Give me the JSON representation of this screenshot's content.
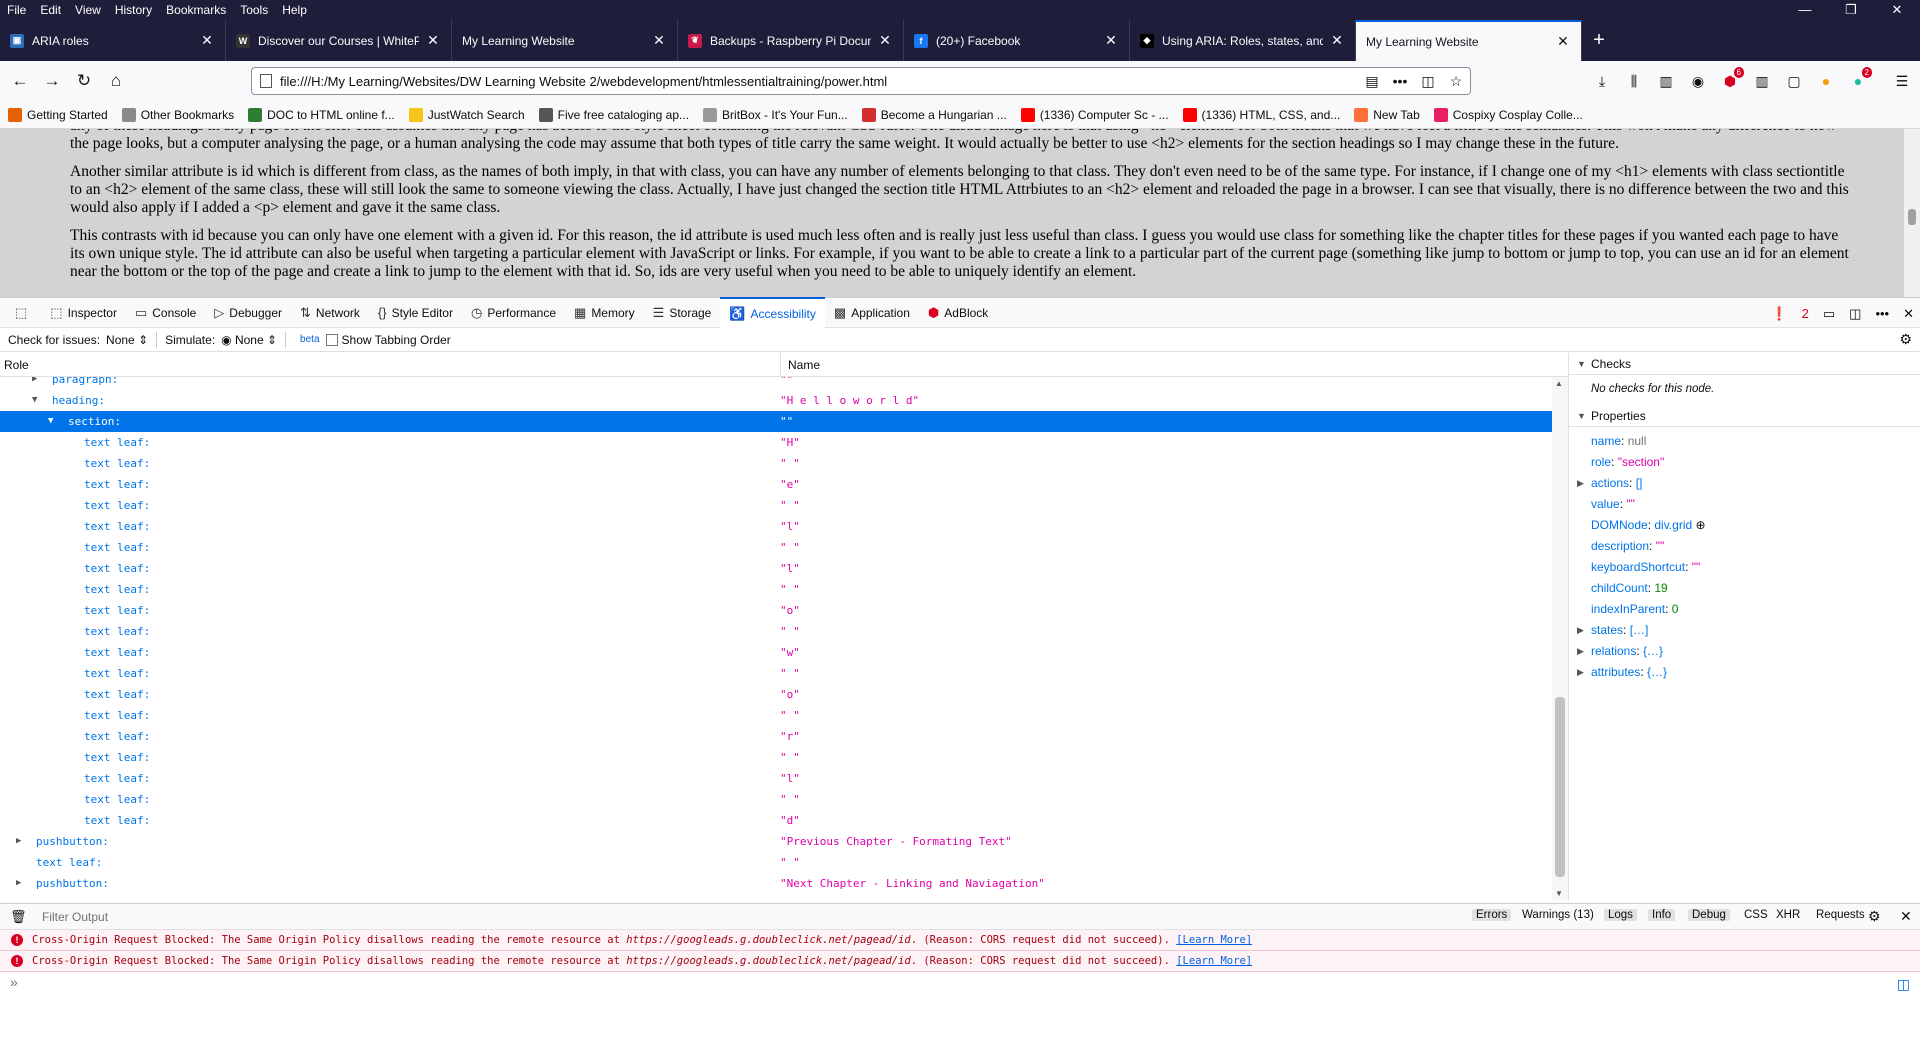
{
  "menu": [
    "File",
    "Edit",
    "View",
    "History",
    "Bookmarks",
    "Tools",
    "Help"
  ],
  "window_controls": [
    "—",
    "❐",
    "✕"
  ],
  "tabs": [
    {
      "title": "ARIA roles",
      "fav_color": "#2a6ebb",
      "fav_text": "▣"
    },
    {
      "title": "Discover our Courses | WhitePe",
      "fav_color": "#333333",
      "fav_text": "W"
    },
    {
      "title": "My Learning Website",
      "fav_color": "",
      "fav_text": ""
    },
    {
      "title": "Backups - Raspberry Pi Docum",
      "fav_color": "#c51a4a",
      "fav_text": "❦"
    },
    {
      "title": "(20+) Facebook",
      "fav_color": "#1877f2",
      "fav_text": "f"
    },
    {
      "title": "Using ARIA: Roles, states, and p",
      "fav_color": "#000000",
      "fav_text": "◆"
    },
    {
      "title": "My Learning Website",
      "fav_color": "",
      "fav_text": "",
      "active": true
    }
  ],
  "new_tab_label": "+",
  "url": "file:///H:/My Learning/Websites/DW Learning Website 2/webdevelopment/htmlessentialtraining/power.html",
  "bookmarks": [
    {
      "label": "Getting Started",
      "color": "#e66000"
    },
    {
      "label": "Other Bookmarks",
      "color": "#8a8a8a"
    },
    {
      "label": "DOC to HTML online f...",
      "color": "#2e7d32"
    },
    {
      "label": "JustWatch Search",
      "color": "#f5c518"
    },
    {
      "label": "Five free cataloging ap...",
      "color": "#555555"
    },
    {
      "label": "BritBox - It's Your Fun...",
      "color": "#999999"
    },
    {
      "label": "Become a Hungarian ...",
      "color": "#d32f2f"
    },
    {
      "label": "(1336) Computer Sc - ...",
      "color": "#ff0000"
    },
    {
      "label": "(1336) HTML, CSS, and...",
      "color": "#ff0000"
    },
    {
      "label": "New Tab",
      "color": "#ff7139"
    },
    {
      "label": "Cospixy Cosplay Colle...",
      "color": "#e91e63"
    }
  ],
  "page": {
    "paragraphs": [
      "any of these headings in any page on the site. This assumes that any page has access to the style sheet containing the relevant CSS rules. One disadvantage here is that using <h1> elements for both means that we have lost a little of the semantics. This won't make any difference to how the page looks, but a computer analysing the page, or a human analysing the code may assume that both types of title carry the same weight. It would actually be better to use <h2> elements for the section headings so I may change these in the future.",
      "Another similar attribute is id which is different from class, as the names of both imply, in that with class, you can have any number of elements belonging to that class. They don't even need to be of the same type. For instance, if I change one of my <h1> elements with class sectiontitle to an <h2> element of the same class, these will still look the same to someone viewing the class. Actually, I have just changed the section title HTML Attrbiutes to an <h2> element and reloaded the page in a browser. I can see that visually, there is no difference between the two and this would also apply if I added a <p> element and gave it the same class.",
      "This contrasts with id because you can only have one element with a given id. For this reason, the id attribute is used much less often and is really just less useful than class. I guess you would use class for something like the chapter titles for these pages if you wanted each page to have its own unique style. The id attribute can also be useful when targeting a particular element with JavaScript or links. For example, if you want to be able to create a link to a particular part of the current page (something like jump to bottom or jump to top, you can use an id for an element near the bottom or the top of the page and create a link to jump to the element with that id. So, ids are very useful when you need to be able to uniquely identify an element."
    ]
  },
  "devtools": {
    "tabs": [
      {
        "label": "Inspector",
        "icon": "⬚"
      },
      {
        "label": "Console",
        "icon": "▭"
      },
      {
        "label": "Debugger",
        "icon": "▷"
      },
      {
        "label": "Network",
        "icon": "⇅"
      },
      {
        "label": "Style Editor",
        "icon": "{}"
      },
      {
        "label": "Performance",
        "icon": "◷"
      },
      {
        "label": "Memory",
        "icon": "▦"
      },
      {
        "label": "Storage",
        "icon": "☰"
      },
      {
        "label": "Accessibility",
        "icon": "♿",
        "active": true
      },
      {
        "label": "Application",
        "icon": "▩"
      },
      {
        "label": "AdBlock",
        "icon": "⬢"
      }
    ],
    "error_count": "2"
  },
  "a11y_toolbar": {
    "check_label": "Check for issues:",
    "check_value": "None ⇕",
    "simulate_label": "Simulate:",
    "simulate_value": "◉ None ⇕",
    "beta": "beta",
    "tabbing_label": "Show Tabbing Order"
  },
  "tree": {
    "col_role": "Role",
    "col_name": "Name",
    "rows": [
      {
        "role": "paragraph:",
        "name": "\"\"",
        "indent": 1,
        "twisty": "▶"
      },
      {
        "role": "heading:",
        "name": "\"H e l l o w o r l d\"",
        "indent": 1,
        "twisty": "▼"
      },
      {
        "role": "section:",
        "name": "\"\"",
        "indent": 2,
        "twisty": "▼",
        "selected": true
      },
      {
        "role": "text leaf:",
        "name": "\"H\"",
        "indent": 3
      },
      {
        "role": "text leaf:",
        "name": "\" \"",
        "indent": 3
      },
      {
        "role": "text leaf:",
        "name": "\"e\"",
        "indent": 3
      },
      {
        "role": "text leaf:",
        "name": "\" \"",
        "indent": 3
      },
      {
        "role": "text leaf:",
        "name": "\"l\"",
        "indent": 3
      },
      {
        "role": "text leaf:",
        "name": "\" \"",
        "indent": 3
      },
      {
        "role": "text leaf:",
        "name": "\"l\"",
        "indent": 3
      },
      {
        "role": "text leaf:",
        "name": "\" \"",
        "indent": 3
      },
      {
        "role": "text leaf:",
        "name": "\"o\"",
        "indent": 3
      },
      {
        "role": "text leaf:",
        "name": "\" \"",
        "indent": 3
      },
      {
        "role": "text leaf:",
        "name": "\"w\"",
        "indent": 3
      },
      {
        "role": "text leaf:",
        "name": "\" \"",
        "indent": 3
      },
      {
        "role": "text leaf:",
        "name": "\"o\"",
        "indent": 3
      },
      {
        "role": "text leaf:",
        "name": "\" \"",
        "indent": 3
      },
      {
        "role": "text leaf:",
        "name": "\"r\"",
        "indent": 3
      },
      {
        "role": "text leaf:",
        "name": "\" \"",
        "indent": 3
      },
      {
        "role": "text leaf:",
        "name": "\"l\"",
        "indent": 3
      },
      {
        "role": "text leaf:",
        "name": "\" \"",
        "indent": 3
      },
      {
        "role": "text leaf:",
        "name": "\"d\"",
        "indent": 3
      },
      {
        "role": "pushbutton:",
        "name": "\"Previous Chapter - Formating Text\"",
        "indent": 0,
        "twisty": "▶"
      },
      {
        "role": "text leaf:",
        "name": "\" \"",
        "indent": 0
      },
      {
        "role": "pushbutton:",
        "name": "\"Next Chapter - Linking and Naviagation\"",
        "indent": 0,
        "twisty": "▶"
      }
    ]
  },
  "sidebar": {
    "checks_title": "Checks",
    "checks_empty": "No checks for this node.",
    "properties_title": "Properties",
    "props": [
      {
        "k": "name",
        "v": "null",
        "t": "null"
      },
      {
        "k": "role",
        "v": "\"section\"",
        "t": "str"
      },
      {
        "k": "actions",
        "v": "[]",
        "t": "obj",
        "expand": true
      },
      {
        "k": "value",
        "v": "\"\"",
        "t": "str"
      },
      {
        "k": "DOMNode",
        "v": "div.grid",
        "t": "node"
      },
      {
        "k": "description",
        "v": "\"\"",
        "t": "str"
      },
      {
        "k": "keyboardShortcut",
        "v": "\"\"",
        "t": "str"
      },
      {
        "k": "childCount",
        "v": "19",
        "t": "num"
      },
      {
        "k": "indexInParent",
        "v": "0",
        "t": "num"
      },
      {
        "k": "states",
        "v": "[…]",
        "t": "obj",
        "expand": true
      },
      {
        "k": "relations",
        "v": "{…}",
        "t": "obj",
        "expand": true
      },
      {
        "k": "attributes",
        "v": "{…}",
        "t": "obj",
        "expand": true
      }
    ]
  },
  "console": {
    "filter_placeholder": "Filter Output",
    "filters": [
      "Errors",
      "Warnings (13)",
      "Logs",
      "Info",
      "Debug",
      "CSS",
      "XHR",
      "Requests"
    ],
    "messages": [
      {
        "pre": "Cross-Origin Request Blocked: The Same Origin Policy disallows reading the remote resource at ",
        "url": "https://googleads.g.doubleclick.net/pagead/id",
        "post": ". (Reason: CORS request did not succeed). ",
        "link": "[Learn More]"
      },
      {
        "pre": "Cross-Origin Request Blocked: The Same Origin Policy disallows reading the remote resource at ",
        "url": "https://googleads.g.doubleclick.net/pagead/id",
        "post": ". (Reason: CORS request did not succeed). ",
        "link": "[Learn More]"
      }
    ],
    "prompt": "»"
  }
}
